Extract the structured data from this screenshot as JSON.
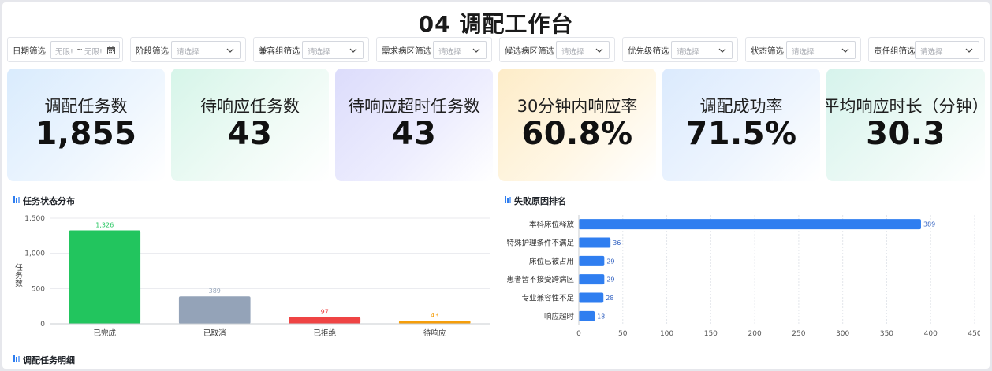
{
  "title": "04 调配工作台",
  "filters": [
    {
      "label": "日期筛选",
      "type": "date",
      "start": "无限!",
      "sep": "~",
      "end": "无限!"
    },
    {
      "label": "阶段筛选",
      "placeholder": "请选择"
    },
    {
      "label": "兼容组筛选",
      "placeholder": "请选择"
    },
    {
      "label": "需求病区筛选",
      "placeholder": "请选择"
    },
    {
      "label": "候选病区筛选",
      "placeholder": "请选择"
    },
    {
      "label": "优先级筛选",
      "placeholder": "请选择"
    },
    {
      "label": "状态筛选",
      "placeholder": "请选择"
    },
    {
      "label": "责任组筛选",
      "placeholder": "请选择"
    }
  ],
  "kpis": [
    {
      "label": "调配任务数",
      "value": "1,855",
      "colors": [
        "#d9ebfd",
        "#eef6fe"
      ]
    },
    {
      "label": "待响应任务数",
      "value": "43",
      "colors": [
        "#d6f5e9",
        "#f0fbf6"
      ]
    },
    {
      "label": "待响应超时任务数",
      "value": "43",
      "colors": [
        "#dcdcfb",
        "#eeeefe"
      ]
    },
    {
      "label": "30分钟内响应率",
      "value": "60.8%",
      "colors": [
        "#fdecc8",
        "#fff7e6"
      ]
    },
    {
      "label": "调配成功率",
      "value": "71.5%",
      "colors": [
        "#dbeafd",
        "#eef5fe"
      ]
    },
    {
      "label": "平均响应时长（分钟）",
      "value": "30.3",
      "colors": [
        "#d6f3ec",
        "#eefaf6"
      ]
    }
  ],
  "sections": {
    "status": "任务状态分布",
    "reasons": "失败原因排名",
    "detail": "调配任务明细"
  },
  "chart_data": [
    {
      "type": "bar",
      "title": "任务状态分布",
      "ylabel": "任务数",
      "categories": [
        "已完成",
        "已取消",
        "已拒绝",
        "待响应"
      ],
      "values": [
        1326,
        389,
        97,
        43
      ],
      "value_labels": [
        "1,326",
        "389",
        "97",
        "43"
      ],
      "colors": [
        "#22c55e",
        "#94a3b8",
        "#ef4444",
        "#f59e0b"
      ],
      "ylim": [
        0,
        1500
      ],
      "yticks": [
        0,
        500,
        1000,
        1500
      ],
      "ytick_labels": [
        "0",
        "500",
        "1,000",
        "1,500"
      ],
      "grid": true
    },
    {
      "type": "bar",
      "orientation": "horizontal",
      "title": "失败原因排名",
      "categories": [
        "本科床位释放",
        "特殊护理条件不满足",
        "床位已被占用",
        "患者暂不接受跨病区",
        "专业兼容性不足",
        "响应超时"
      ],
      "values": [
        389,
        36,
        29,
        29,
        28,
        18
      ],
      "color": "#2f7ef0",
      "xlim": [
        0,
        450
      ],
      "xticks": [
        0,
        50,
        100,
        150,
        200,
        250,
        300,
        350,
        400,
        450
      ],
      "grid": true
    }
  ]
}
